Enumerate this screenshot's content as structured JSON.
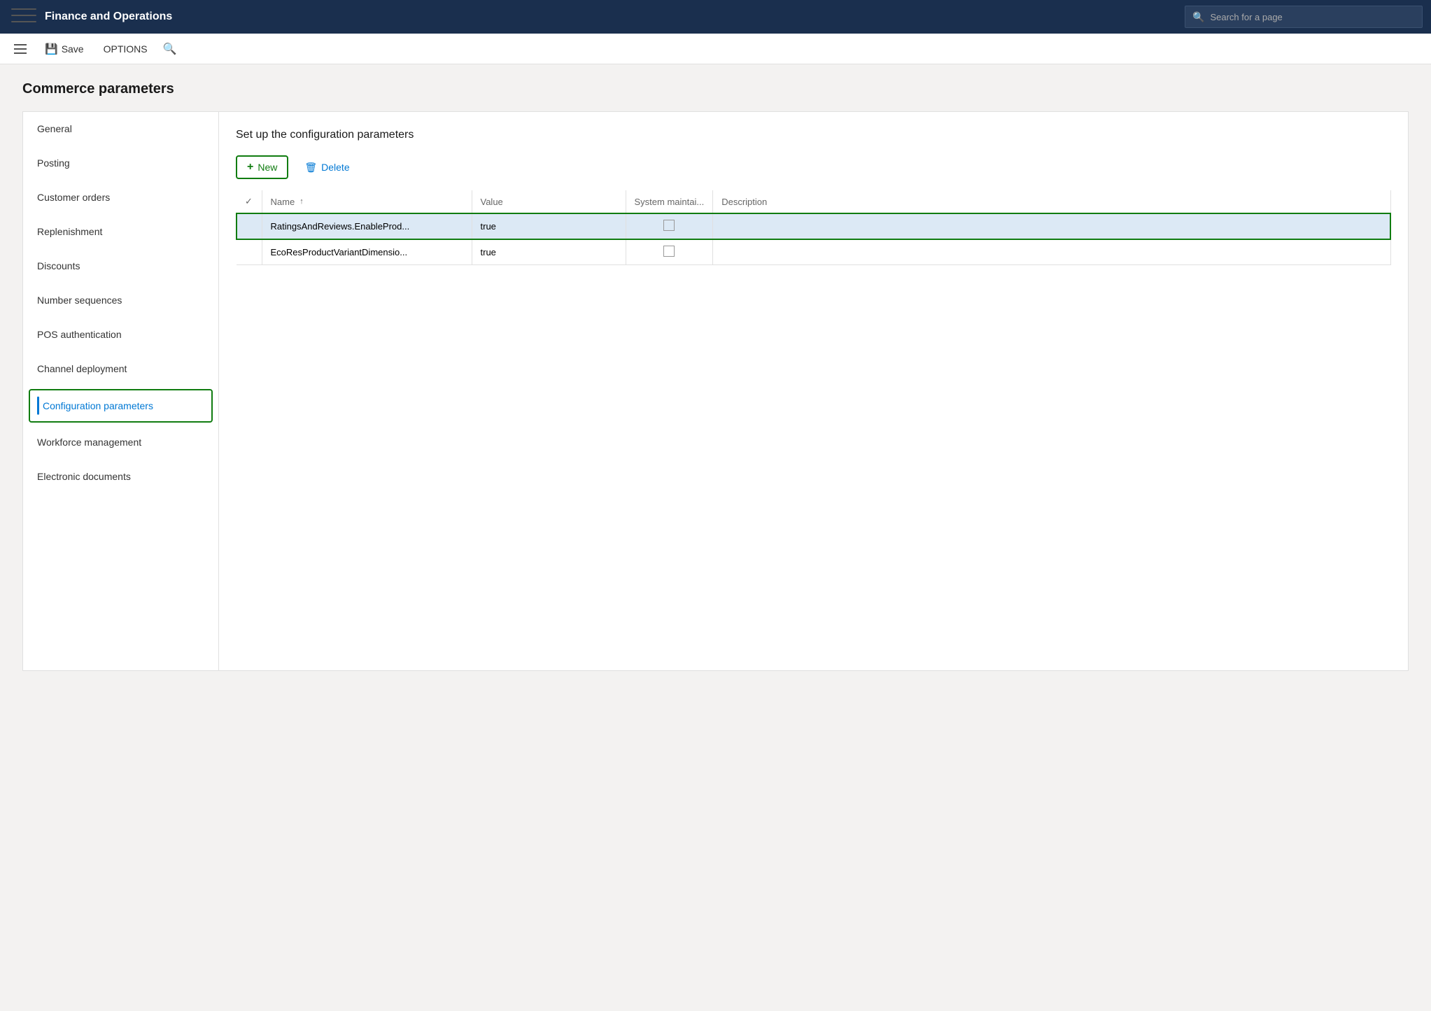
{
  "app": {
    "title": "Finance and Operations",
    "search_placeholder": "Search for a page"
  },
  "toolbar": {
    "save_label": "Save",
    "options_label": "OPTIONS"
  },
  "page": {
    "title": "Commerce parameters"
  },
  "sidebar": {
    "items": [
      {
        "id": "general",
        "label": "General",
        "active": false
      },
      {
        "id": "posting",
        "label": "Posting",
        "active": false
      },
      {
        "id": "customer-orders",
        "label": "Customer orders",
        "active": false
      },
      {
        "id": "replenishment",
        "label": "Replenishment",
        "active": false
      },
      {
        "id": "discounts",
        "label": "Discounts",
        "active": false
      },
      {
        "id": "number-sequences",
        "label": "Number sequences",
        "active": false
      },
      {
        "id": "pos-authentication",
        "label": "POS authentication",
        "active": false
      },
      {
        "id": "channel-deployment",
        "label": "Channel deployment",
        "active": false
      },
      {
        "id": "configuration-parameters",
        "label": "Configuration parameters",
        "active": true
      },
      {
        "id": "workforce-management",
        "label": "Workforce management",
        "active": false
      },
      {
        "id": "electronic-documents",
        "label": "Electronic documents",
        "active": false
      }
    ]
  },
  "content": {
    "section_title": "Set up the configuration parameters",
    "new_button": "New",
    "delete_button": "Delete",
    "table": {
      "headers": {
        "check": "",
        "name": "Name",
        "value": "Value",
        "system_maintained": "System maintai...",
        "description": "Description"
      },
      "rows": [
        {
          "selected": true,
          "name": "RatingsAndReviews.EnableProd...",
          "value": "true",
          "system_maintained": false,
          "description": ""
        },
        {
          "selected": false,
          "name": "EcoResProductVariantDimensio...",
          "value": "true",
          "system_maintained": false,
          "description": ""
        }
      ]
    }
  }
}
